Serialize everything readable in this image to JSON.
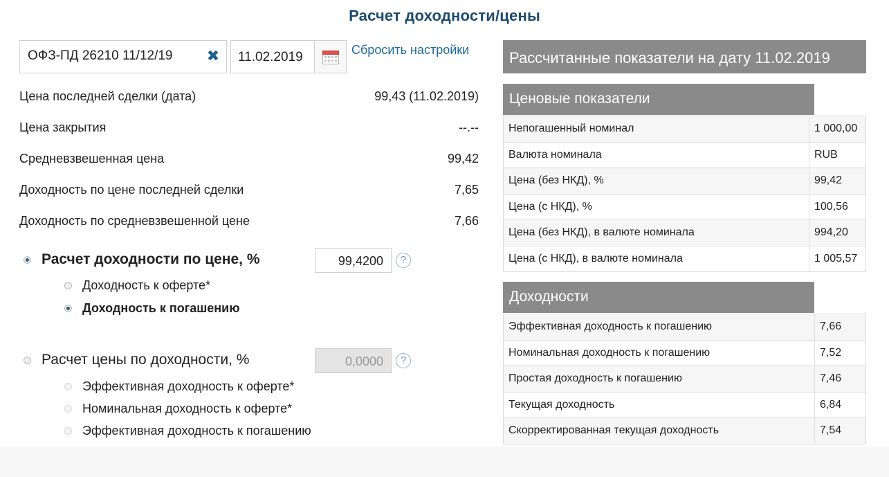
{
  "title": "Расчет доходности/цены",
  "bond_selector": {
    "value": "ОФЗ-ПД 26210 11/12/19",
    "clear_icon": "close-icon"
  },
  "date_picker": {
    "value": "11.02.2019",
    "icon": "calendar-icon"
  },
  "reset_link": "Сбросить настройки",
  "info": [
    {
      "label": "Цена последней сделки (дата)",
      "value": "99,43 (11.02.2019)"
    },
    {
      "label": "Цена закрытия",
      "value": "--.--"
    },
    {
      "label": "Средневзвешенная цена",
      "value": "99,42"
    },
    {
      "label": "Доходность по цене последней сделки",
      "value": "7,65"
    },
    {
      "label": "Доходность по средневзвешенной цене",
      "value": "7,66"
    }
  ],
  "yield_by_price": {
    "label": "Расчет доходности по цене, %",
    "input_value": "99,4200",
    "selected": true,
    "options": [
      {
        "label": "Доходность к оферте*",
        "selected": false
      },
      {
        "label": "Доходность к погашению",
        "selected": true
      }
    ]
  },
  "price_by_yield": {
    "label": "Расчет цены по доходности, %",
    "input_value": "0,0000",
    "selected": false,
    "options": [
      {
        "label": "Эффективная доходность к оферте*"
      },
      {
        "label": "Номинальная доходность к оферте*"
      },
      {
        "label": "Эффективная доходность к погашению"
      }
    ]
  },
  "help_symbol": "?",
  "right_panel": {
    "header": "Рассчитанные показатели на дату 11.02.2019",
    "price_section": {
      "title": "Ценовые показатели",
      "rows": [
        {
          "label": "Непогашенный номинал",
          "value": "1 000,00"
        },
        {
          "label": "Валюта номинала",
          "value": "RUB"
        },
        {
          "label": "Цена (без НКД), %",
          "value": "99,42"
        },
        {
          "label": "Цена (с НКД), %",
          "value": "100,56"
        },
        {
          "label": "Цена (без НКД), в валюте номинала",
          "value": "994,20"
        },
        {
          "label": "Цена (с НКД), в валюте номинала",
          "value": "1 005,57"
        }
      ]
    },
    "yield_section": {
      "title": "Доходности",
      "rows": [
        {
          "label": "Эффективная доходность к погашению",
          "value": "7,66"
        },
        {
          "label": "Номинальная доходность к погашению",
          "value": "7,52"
        },
        {
          "label": "Простая доходность к погашению",
          "value": "7,46"
        },
        {
          "label": "Текущая доходность",
          "value": "6,84"
        },
        {
          "label": "Скорректированная текущая доходность",
          "value": "7,54"
        }
      ]
    }
  },
  "colors": {
    "title": "#1e4b6e",
    "link": "#1e6a9a",
    "header_bg": "#8a8a8a",
    "clear_icon": "#1e5f8c"
  }
}
